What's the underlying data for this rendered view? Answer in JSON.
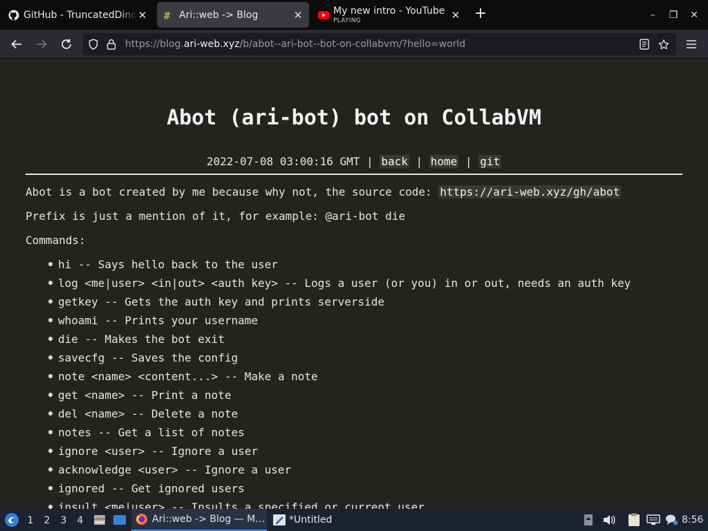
{
  "browser": {
    "tabs": [
      {
        "title": "GitHub - TruncatedDinosour",
        "icon": "github-icon",
        "active": false
      },
      {
        "title": "Ari::web -> Blog",
        "icon": "ari-web-icon",
        "active": true
      },
      {
        "title": "My new intro - YouTube",
        "subtitle": "PLAYING",
        "icon": "youtube-icon",
        "active": false
      }
    ],
    "new_tab": "+",
    "window_controls": {
      "minimize": "–",
      "maximize": "❐",
      "close": "✕"
    },
    "url": {
      "scheme": "https://blog.",
      "host": "ari-web.xyz",
      "path": "/b/abot--ari-bot--bot-on-collabvm/?hello=world"
    }
  },
  "page": {
    "title": "Abot (ari-bot) bot on CollabVM",
    "meta": {
      "date": "2022-07-08 03:00:16 GMT",
      "sep": "|",
      "back": "back",
      "home": "home",
      "git": "git"
    },
    "intro_text": "Abot is a bot created by me because why not, the source code: ",
    "intro_link": "https://ari-web.xyz/gh/abot",
    "prefix_text": "Prefix is just a mention of it, for example: @ari-bot die",
    "commands_label": "Commands:",
    "commands": [
      "hi -- Says hello back to the user",
      "log <me|user> <in|out> <auth key> -- Logs a user (or you) in or out, needs an auth key",
      "getkey -- Gets the auth key and prints serverside",
      "whoami -- Prints your username",
      "die -- Makes the bot exit",
      "savecfg -- Saves the config",
      "note <name> <content...> -- Make a note",
      "get <name> -- Print a note",
      "del <name> -- Delete a note",
      "notes -- Get a list of notes",
      "ignore <user> -- Ignore a user",
      "acknowledge <user> -- Ignore a user",
      "ignored -- Get ignored users",
      "insult <me|user> -- Insults a specified or current user"
    ]
  },
  "taskbar": {
    "workspaces": [
      "1",
      "2",
      "3",
      "4"
    ],
    "active_workspace": "1",
    "tasks": [
      {
        "title": "Ari::web -> Blog — M…",
        "icon": "firefox-icon",
        "active": true
      },
      {
        "title": "*Untitled",
        "icon": "text-editor-icon",
        "active": false
      }
    ],
    "clock": "8:56"
  }
}
